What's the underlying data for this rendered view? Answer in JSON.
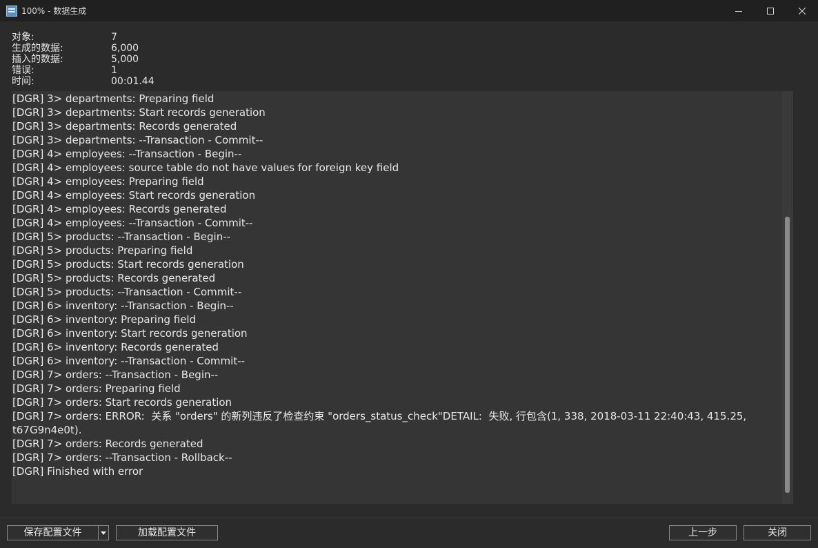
{
  "window": {
    "title": "100% - 数据生成",
    "icon": "database-icon"
  },
  "stats": [
    {
      "label": "对象:",
      "value": "7"
    },
    {
      "label": "生成的数据:",
      "value": "6,000"
    },
    {
      "label": "插入的数据:",
      "value": "5,000"
    },
    {
      "label": "错误:",
      "value": "1"
    },
    {
      "label": "时间:",
      "value": "00:01.44"
    }
  ],
  "log": [
    "[DGR] 3> departments: Preparing field",
    "[DGR] 3> departments: Start records generation",
    "[DGR] 3> departments: Records generated",
    "[DGR] 3> departments: --Transaction - Commit--",
    "[DGR] 4> employees: --Transaction - Begin--",
    "[DGR] 4> employees: source table do not have values for foreign key field",
    "[DGR] 4> employees: Preparing field",
    "[DGR] 4> employees: Start records generation",
    "[DGR] 4> employees: Records generated",
    "[DGR] 4> employees: --Transaction - Commit--",
    "[DGR] 5> products: --Transaction - Begin--",
    "[DGR] 5> products: Preparing field",
    "[DGR] 5> products: Start records generation",
    "[DGR] 5> products: Records generated",
    "[DGR] 5> products: --Transaction - Commit--",
    "[DGR] 6> inventory: --Transaction - Begin--",
    "[DGR] 6> inventory: Preparing field",
    "[DGR] 6> inventory: Start records generation",
    "[DGR] 6> inventory: Records generated",
    "[DGR] 6> inventory: --Transaction - Commit--",
    "[DGR] 7> orders: --Transaction - Begin--",
    "[DGR] 7> orders: Preparing field",
    "[DGR] 7> orders: Start records generation",
    "[DGR] 7> orders: ERROR:  关系 \"orders\" 的新列违反了检查约束 \"orders_status_check\"DETAIL:  失败, 行包含(1, 338, 2018-03-11 22:40:43, 415.25, t67G9n4e0t).",
    "[DGR] 7> orders: Records generated",
    "[DGR] 7> orders: --Transaction - Rollback--",
    "[DGR] Finished with error"
  ],
  "buttons": {
    "save_config": "保存配置文件",
    "load_config": "加载配置文件",
    "previous": "上一步",
    "close": "关闭"
  },
  "colors": {
    "window_bg": "#2b2b2b",
    "titlebar_bg": "#202020",
    "log_bg": "#353535",
    "text": "#e6e6e6"
  }
}
